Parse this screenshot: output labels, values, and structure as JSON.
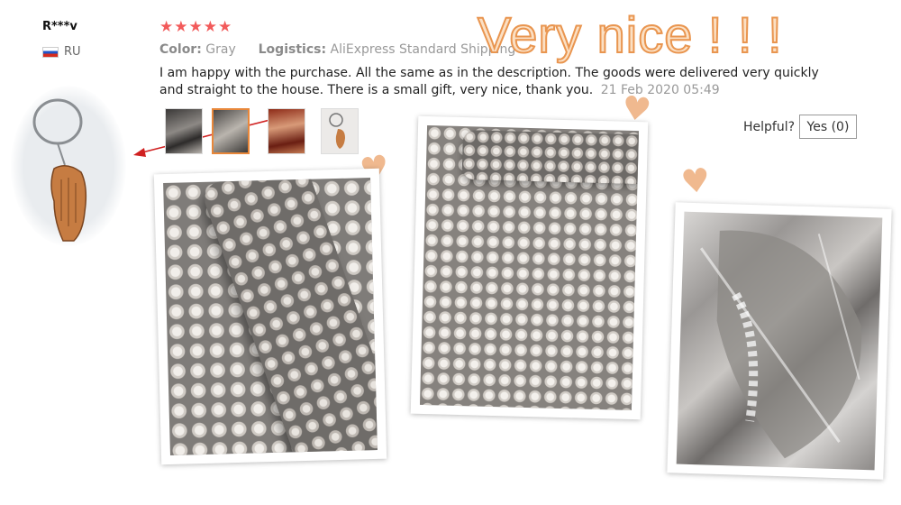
{
  "review": {
    "user_name": "R***v",
    "country": "RU",
    "stars": "★★★★★",
    "color_label": "Color:",
    "color_value": "Gray",
    "logistics_label": "Logistics:",
    "logistics_value": "AliExpress Standard Shipping",
    "text": "I am happy with the purchase. All the same as in the description. The goods were delivered very quickly and straight to the house. There is a small gift, very nice, thank you.",
    "date": "21 Feb 2020 05:49",
    "overlay_title": "Very nice ! ! !"
  },
  "thumbnails": [
    {
      "name": "thumb-1",
      "selected": false
    },
    {
      "name": "thumb-2",
      "selected": true
    },
    {
      "name": "thumb-3",
      "selected": false
    },
    {
      "name": "thumb-4",
      "selected": false
    }
  ],
  "helpful": {
    "label": "Helpful?",
    "button": "Yes (0)"
  },
  "colors": {
    "stars": "#f25a5a",
    "title_fill": "#fbe0c4",
    "title_stroke": "#e9954f",
    "heart": "#f0b98f",
    "selected_thumb_border": "#e8873a",
    "arrow": "#d02020"
  },
  "icons": [
    "flag-icon",
    "star-icon",
    "heart-icon",
    "arrow-icon"
  ]
}
